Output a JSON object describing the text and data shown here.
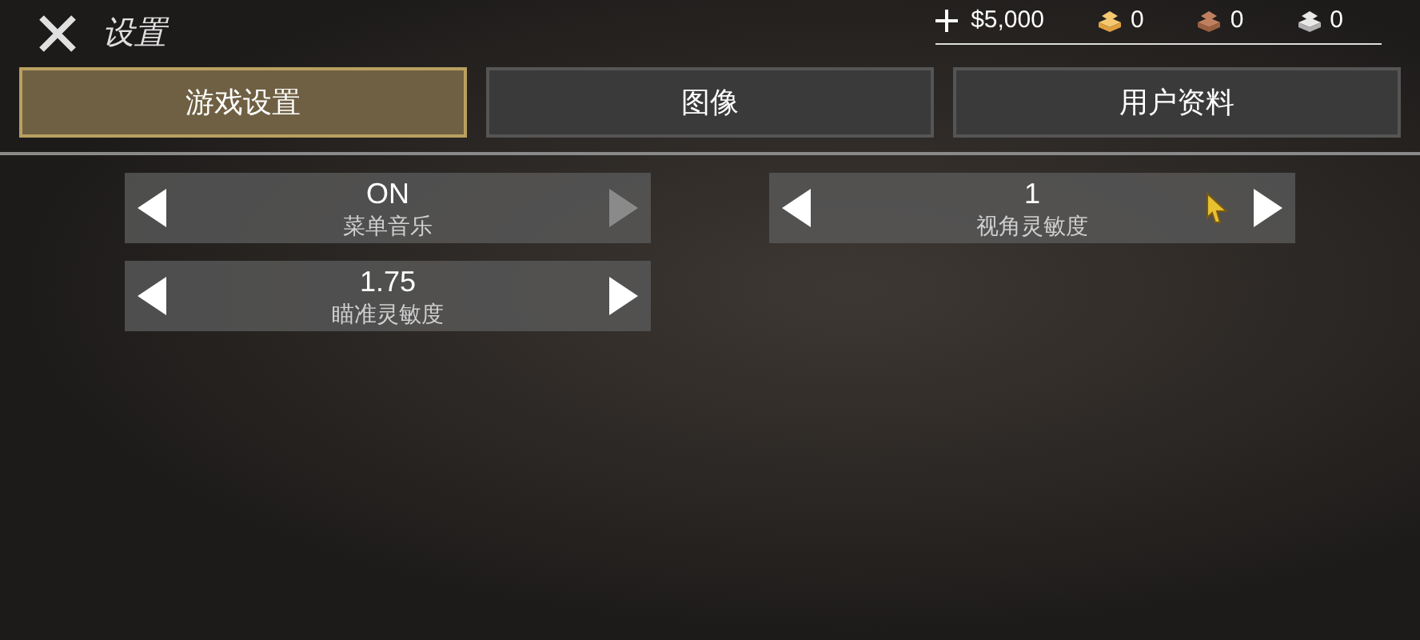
{
  "header": {
    "title": "设置",
    "money": "$5,000",
    "resources": [
      {
        "kind": "gold",
        "amount": "0"
      },
      {
        "kind": "wood",
        "amount": "0"
      },
      {
        "kind": "stone",
        "amount": "0"
      }
    ]
  },
  "tabs": [
    {
      "label": "游戏设置",
      "selected": true
    },
    {
      "label": "图像",
      "selected": false
    },
    {
      "label": "用户资料",
      "selected": false
    }
  ],
  "settings_left": [
    {
      "value": "ON",
      "label": "菜单音乐",
      "prev_disabled": false,
      "next_disabled": true
    },
    {
      "value": "1.75",
      "label": "瞄准灵敏度",
      "prev_disabled": false,
      "next_disabled": false
    }
  ],
  "settings_right": [
    {
      "value": "1",
      "label": "视角灵敏度",
      "prev_disabled": false,
      "next_disabled": false,
      "cursor": true
    }
  ]
}
